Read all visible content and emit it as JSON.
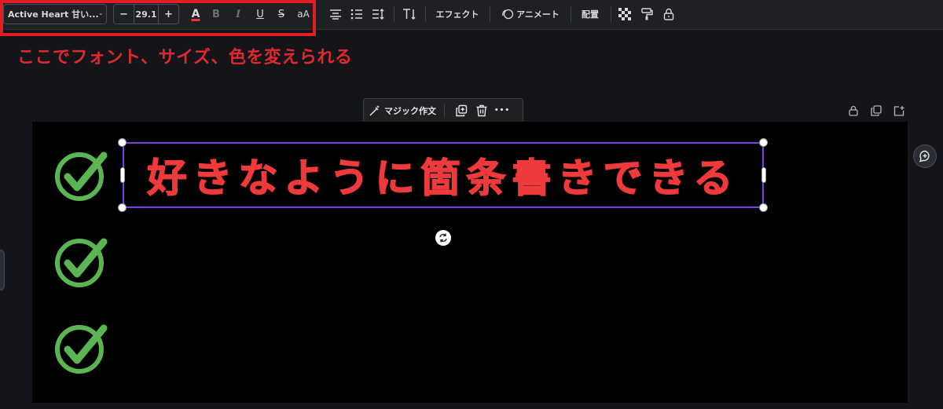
{
  "toolbar": {
    "font_name": "Active Heart 甘い...",
    "font_size": "29.1",
    "decrease": "−",
    "increase": "+",
    "text_color_glyph": "A",
    "bold_glyph": "B",
    "italic_glyph": "I",
    "underline_glyph": "U",
    "strike_glyph": "S",
    "case_glyph": "aA",
    "effects_label": "エフェクト",
    "animate_label": "アニメート",
    "position_label": "配置"
  },
  "annotation": "ここでフォント、サイズ、色を変えられる",
  "mini_toolbar": {
    "magic_write_label": "マジック作文",
    "more_glyph": "•••"
  },
  "canvas": {
    "headline": "好きなように箇条書きできる",
    "checkmark_count": 3
  },
  "colors": {
    "highlight": "#e31d24",
    "headline_text": "#ee3a3a",
    "checkmark": "#5ab552",
    "selection": "#7b3fe4"
  }
}
